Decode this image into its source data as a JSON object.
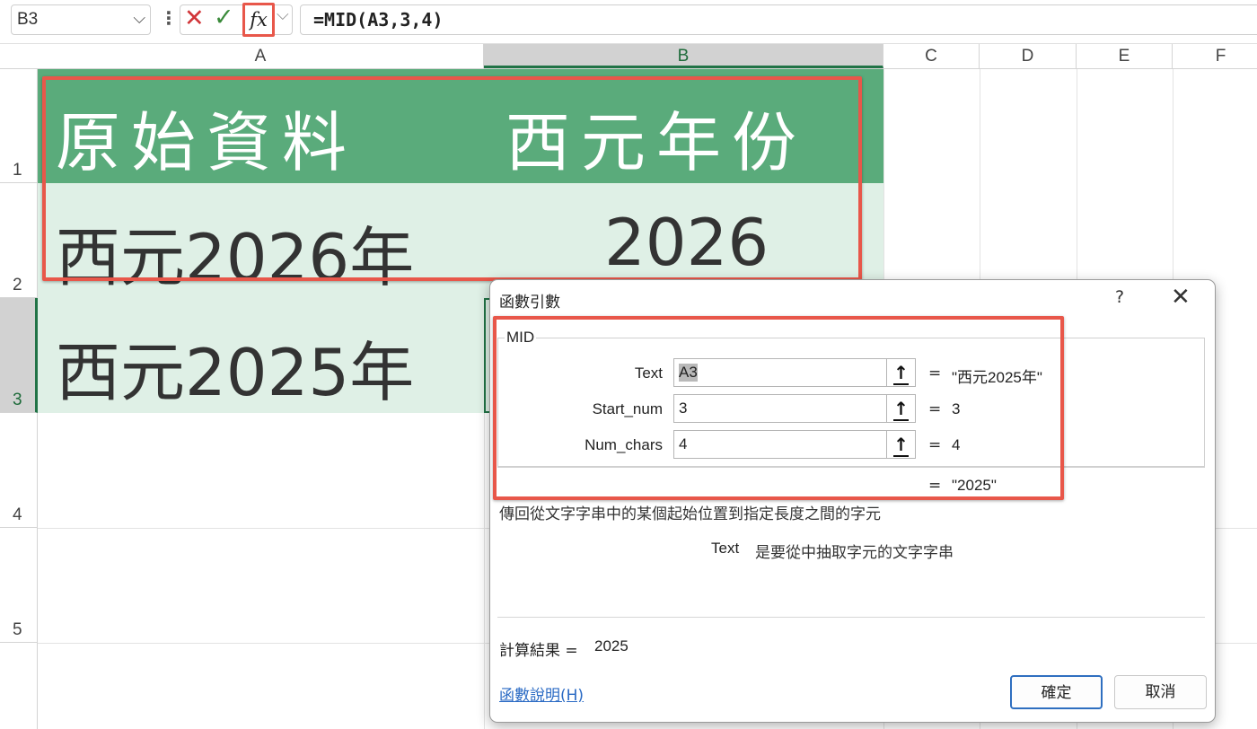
{
  "formula_bar": {
    "name_box": "B3",
    "formula": "=MID(A3,3,4)",
    "fx_label": "fx"
  },
  "columns": [
    "A",
    "B",
    "C",
    "D",
    "E",
    "F"
  ],
  "rows": [
    "1",
    "2",
    "3",
    "4",
    "5"
  ],
  "cells": {
    "A1": "原始資料",
    "B1": "西元年份",
    "A2": "西元2026年",
    "B2": "2026",
    "A3": "西元2025年"
  },
  "colors": {
    "header_fill": "#5aab7b",
    "data_fill": "#dff0e6",
    "highlight_red": "#e8574a",
    "selection_green": "#217346",
    "link_blue": "#2a6ac4"
  },
  "dialog": {
    "title": "函數引數",
    "help": "?",
    "close": "✕",
    "function_name": "MID",
    "args": [
      {
        "label": "Text",
        "value": "A3",
        "result": "\"西元2025年\""
      },
      {
        "label": "Start_num",
        "value": "3",
        "result": "3"
      },
      {
        "label": "Num_chars",
        "value": "4",
        "result": "4"
      }
    ],
    "eq": "=",
    "formula_result": "\"2025\"",
    "description": "傳回從文字字串中的某個起始位置到指定長度之間的字元",
    "arg_desc_name": "Text",
    "arg_desc_text": "是要從中抽取字元的文字字串",
    "calc_result_label": "計算結果 =",
    "calc_result_value": "2025",
    "help_link": "函數說明(H)",
    "ok": "確定",
    "cancel": "取消"
  }
}
